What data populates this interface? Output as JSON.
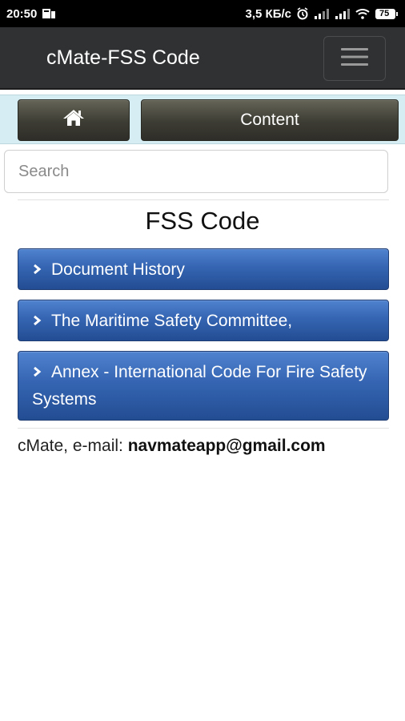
{
  "status_bar": {
    "time": "20:50",
    "network_speed": "3,5 КБ/с",
    "battery": "75",
    "icons": [
      "notification-icon",
      "alarm-icon",
      "signal-icon",
      "signal-icon",
      "wifi-icon",
      "battery-icon"
    ]
  },
  "app_bar": {
    "title": "cMate-FSS Code",
    "menu_icon": "hamburger-menu-icon"
  },
  "nav": {
    "home_icon": "home-icon",
    "content_label": "Content"
  },
  "search": {
    "placeholder": "Search",
    "value": ""
  },
  "page": {
    "heading": "FSS Code",
    "items": [
      {
        "label": "Document History"
      },
      {
        "label": "The Maritime Safety Committee,"
      },
      {
        "label": "Annex - International Code For Fire Safety Systems"
      }
    ]
  },
  "footer": {
    "prefix": "cMate, e-mail: ",
    "email": "navmateapp@gmail.com"
  },
  "colors": {
    "app_bar": "#2f3133",
    "nav_strip": "#d6eef3",
    "nav_button": "#3d3c34",
    "item_blue": "#3565b2"
  }
}
